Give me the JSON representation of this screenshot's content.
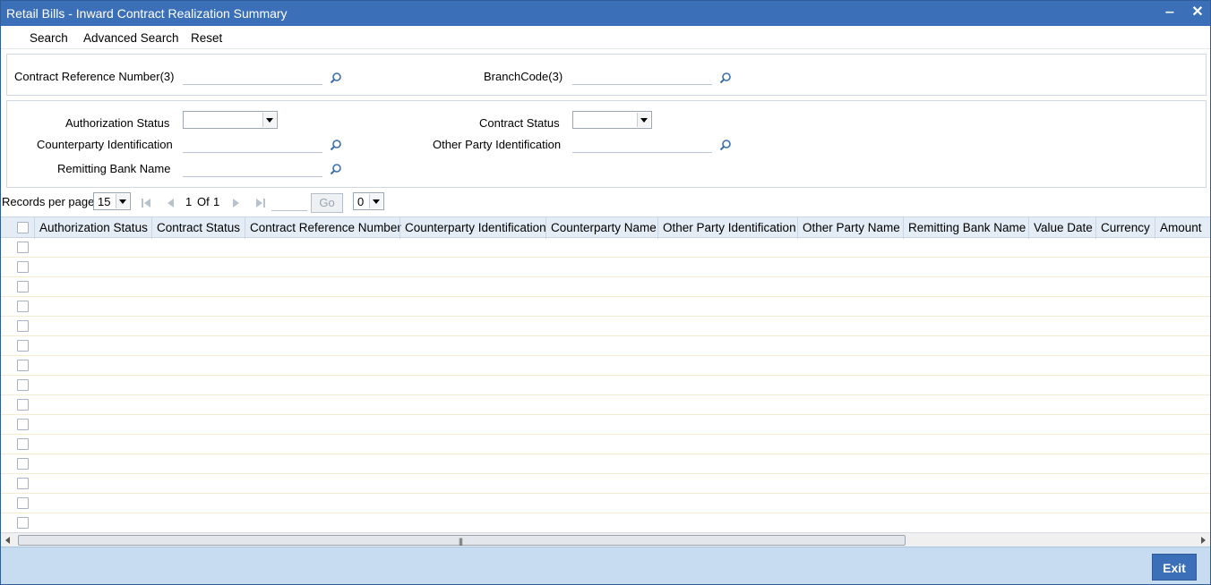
{
  "window": {
    "title": "Retail Bills - Inward Contract Realization Summary",
    "minimize_label": "‒",
    "close_label": "✕"
  },
  "menu": {
    "search": "Search",
    "advanced_search": "Advanced Search",
    "reset": "Reset"
  },
  "fields": {
    "contract_ref_label": "Contract Reference Number(3)",
    "contract_ref_value": "",
    "branch_code_label": "BranchCode(3)",
    "branch_code_value": "",
    "auth_status_label": "Authorization Status",
    "auth_status_value": "",
    "contract_status_label": "Contract Status",
    "contract_status_value": "",
    "counterparty_id_label": "Counterparty Identification",
    "counterparty_id_value": "",
    "other_party_id_label": "Other Party Identification",
    "other_party_id_value": "",
    "remitting_bank_label": "Remitting Bank Name",
    "remitting_bank_value": ""
  },
  "pager": {
    "records_per_page_label": "Records per page",
    "records_per_page_value": "15",
    "current_page": "1",
    "of_label": "Of",
    "total_pages": "1",
    "go_label": "Go",
    "page_select_value": "0"
  },
  "grid": {
    "columns": [
      "Authorization Status",
      "Contract Status",
      "Contract Reference Number",
      "Counterparty Identification",
      "Counterparty Name",
      "Other Party Identification",
      "Other Party Name",
      "Remitting Bank Name",
      "Value Date",
      "Currency",
      "Amount"
    ],
    "row_count": 15
  },
  "footer": {
    "exit_label": "Exit"
  },
  "colors": {
    "titlebar": "#3b70b9",
    "header_bg": "#e4ecf5",
    "footer_bg": "#c7dcf0"
  }
}
